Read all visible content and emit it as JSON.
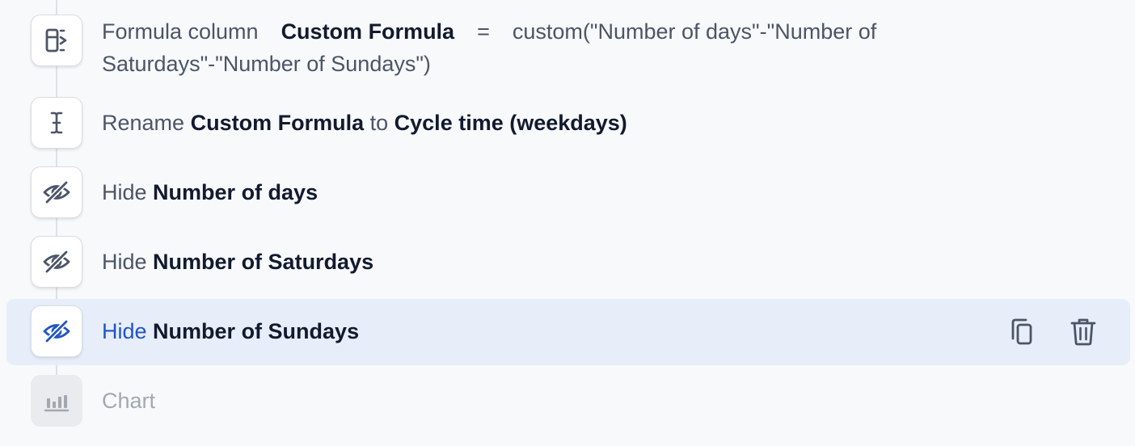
{
  "steps": [
    {
      "icon": "formula-column-icon",
      "prefix": "Formula column",
      "column": "Custom Formula",
      "operator": "=",
      "formula_line1": "custom(\"Number of days\"-\"Number of",
      "formula_line2": "Saturdays\"-\"Number of Sundays\")"
    },
    {
      "icon": "rename-cursor-icon",
      "prefix": "Rename",
      "from": "Custom Formula",
      "connector": "to",
      "to": "Cycle time (weekdays)"
    },
    {
      "icon": "eye-off-icon",
      "prefix": "Hide",
      "column": "Number of days"
    },
    {
      "icon": "eye-off-icon",
      "prefix": "Hide",
      "column": "Number of Saturdays"
    },
    {
      "icon": "eye-off-icon",
      "prefix": "Hide",
      "column": "Number of Sundays",
      "state": "selected",
      "actions": [
        "copy-icon",
        "trash-icon"
      ]
    },
    {
      "icon": "bar-chart-icon",
      "label": "Chart",
      "state": "disabled"
    }
  ],
  "colors": {
    "background": "#f8f9fb",
    "highlight": "#e7eefa",
    "accent": "#2155c4",
    "text": "#4b5567",
    "strong_text": "#111a2e",
    "muted_text": "#a2a8b2"
  }
}
